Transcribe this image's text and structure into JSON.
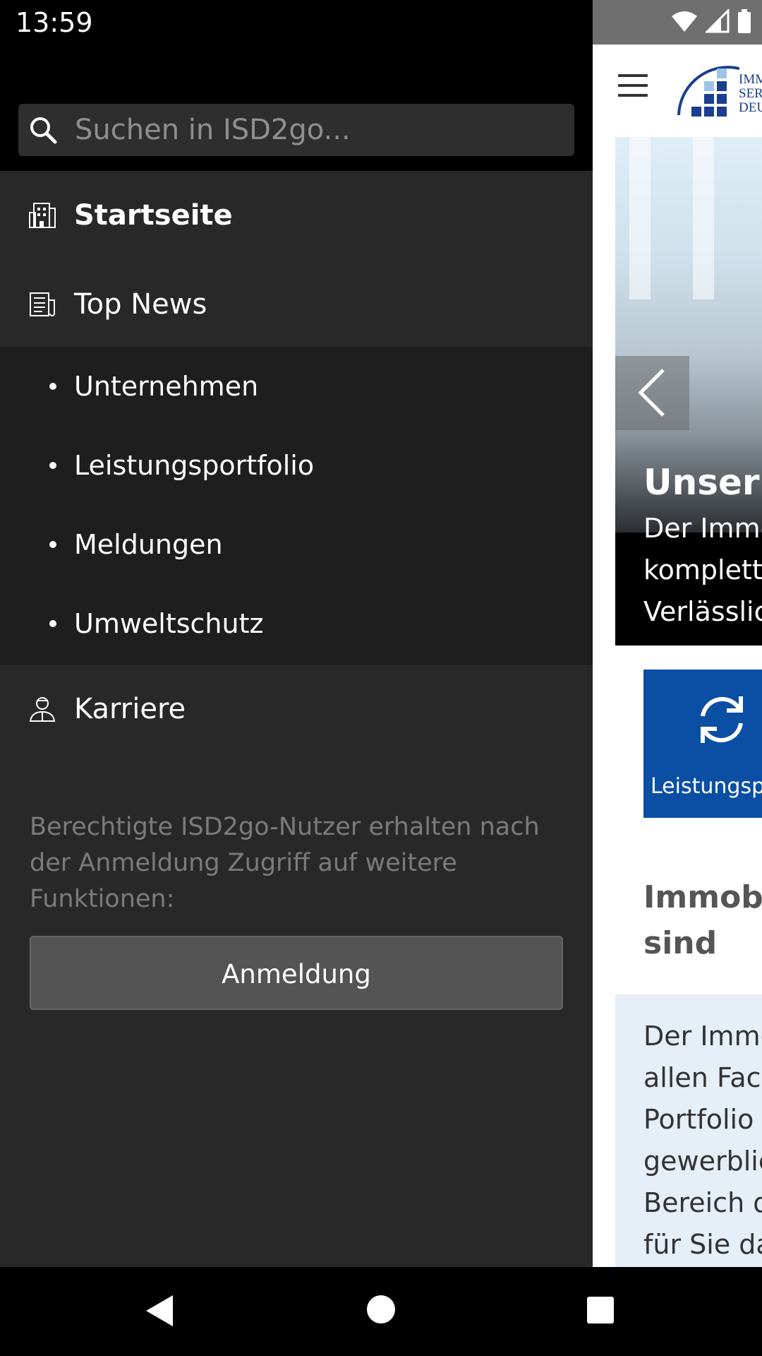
{
  "status_bar": {
    "time": "13:59"
  },
  "drawer": {
    "search": {
      "placeholder": "Suchen in ISD2go..."
    },
    "items": [
      {
        "label": "Startseite",
        "icon": "building-icon",
        "active": true
      },
      {
        "label": "Top News",
        "icon": "newspaper-icon"
      }
    ],
    "subitems": [
      {
        "label": "Unternehmen"
      },
      {
        "label": "Leistungsportfolio"
      },
      {
        "label": "Meldungen"
      },
      {
        "label": "Umweltschutz"
      }
    ],
    "karriere": {
      "label": "Karriere",
      "icon": "person-icon"
    },
    "info_text": "Berechtigte ISD2go-Nutzer erhalten nach der Anmeldung Zugriff auf weitere Funktionen:",
    "login_label": "Anmeldung"
  },
  "content": {
    "logo_text": [
      "IMM",
      "SER",
      "DEU"
    ],
    "hero_title": "Unser L",
    "hero_lines": [
      "Der Immo",
      "komplette",
      "Verlässlic"
    ],
    "tile_label": "Leistungsp",
    "section_heading": [
      "Immobi",
      "sind"
    ],
    "info_lines": [
      "Der Immo",
      "allen Face",
      "Portfolio",
      "gewerblic",
      "Bereich d",
      "für Sie da"
    ]
  },
  "colors": {
    "drawer_bg": "#282828",
    "submenu_bg": "#1e1e1e",
    "brand_blue": "#0a4fa4",
    "info_box_bg": "#e6eef8"
  }
}
